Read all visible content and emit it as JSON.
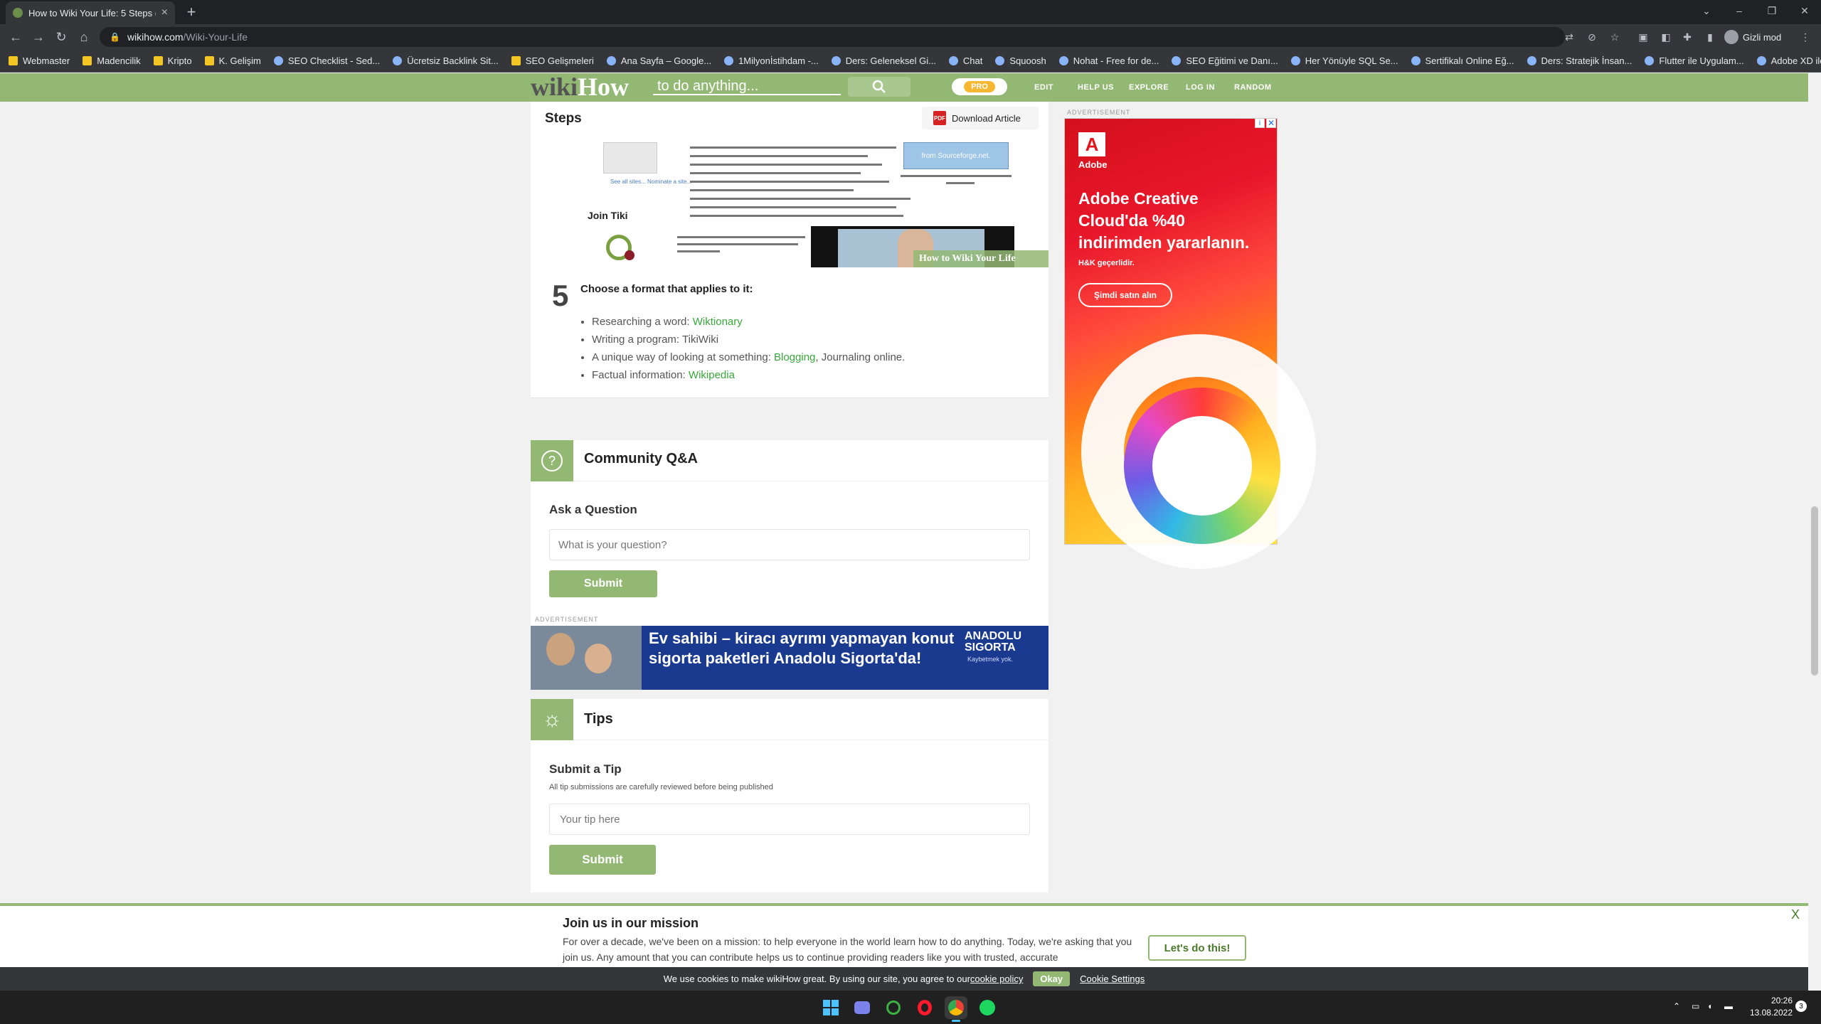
{
  "browser": {
    "tab_title": "How to Wiki Your Life: 5 Steps (w...",
    "url_host": "wikihow.com",
    "url_path": "/Wiki-Your-Life",
    "profile_label": "Gizli mod",
    "bookmarks": [
      {
        "label": "Webmaster",
        "kind": "folder"
      },
      {
        "label": "Madencilik",
        "kind": "folder"
      },
      {
        "label": "Kripto",
        "kind": "folder"
      },
      {
        "label": "K. Gelişim",
        "kind": "folder"
      },
      {
        "label": "SEO Checklist - Sed...",
        "kind": "site"
      },
      {
        "label": "Ücretsiz Backlink Sit...",
        "kind": "site"
      },
      {
        "label": "SEO Gelişmeleri",
        "kind": "folder"
      },
      {
        "label": "Ana Sayfa – Google...",
        "kind": "site"
      },
      {
        "label": "1Milyonİstihdam -...",
        "kind": "site"
      },
      {
        "label": "Ders: Geleneksel Gi...",
        "kind": "site"
      },
      {
        "label": "Chat",
        "kind": "site"
      },
      {
        "label": "Squoosh",
        "kind": "site"
      },
      {
        "label": "Nohat - Free for de...",
        "kind": "site"
      },
      {
        "label": "SEO Eğitimi ve Danı...",
        "kind": "site"
      },
      {
        "label": "Her Yönüyle SQL Se...",
        "kind": "site"
      },
      {
        "label": "Sertifikalı Online Eğ...",
        "kind": "site"
      },
      {
        "label": "Ders: Stratejik İnsan...",
        "kind": "site"
      },
      {
        "label": "Flutter ile Uygulam...",
        "kind": "site"
      },
      {
        "label": "Adobe XD ile UI-UX...",
        "kind": "site"
      }
    ]
  },
  "header": {
    "logo_a": "wiki",
    "logo_b": "How",
    "search_placeholder": "to do anything...",
    "pro_label": "PRO",
    "nav": [
      "EDIT",
      "HELP US",
      "EXPLORE",
      "LOG IN",
      "RANDOM"
    ]
  },
  "steps": {
    "title": "Steps",
    "download_label": "Download Article",
    "image": {
      "join_tiki": "Join Tiki",
      "see_all": "See all sites...\nNominate a site...",
      "sf_note": "from Sourceforge.net.",
      "video_caption": "How to Wiki Your Life"
    },
    "step5": {
      "number": "5",
      "heading": "Choose a format that applies to it:",
      "items": [
        {
          "prefix": "Researching a word: ",
          "link": "Wiktionary",
          "suffix": ""
        },
        {
          "prefix": "Writing a program: ",
          "link": "",
          "suffix": "TikiWiki"
        },
        {
          "prefix": "A unique way of looking at something: ",
          "link": "Blogging",
          "suffix": ", Journaling online."
        },
        {
          "prefix": "Factual information: ",
          "link": "Wikipedia",
          "suffix": ""
        }
      ]
    }
  },
  "qa": {
    "title": "Community Q&A",
    "ask_label": "Ask a Question",
    "input_placeholder": "What is your question?",
    "submit": "Submit"
  },
  "ads": {
    "label": "ADVERTISEMENT",
    "right": {
      "brand": "Adobe",
      "headline": "Adobe Creative Cloud'da %40 indirimden yararlanın.",
      "note": "H&K geçerlidir.",
      "cta": "Şimdi satın alın"
    },
    "banner": {
      "text": "Ev sahibi – kiracı ayrımı yapmayan konut sigorta paketleri Anadolu Sigorta'da!",
      "brand": "ANADOLU SIGORTA",
      "slogan": "Kaybetmek yok."
    }
  },
  "tips": {
    "title": "Tips",
    "submit_label": "Submit a Tip",
    "note": "All tip submissions are carefully reviewed before being published",
    "input_placeholder": "Your tip here",
    "submit": "Submit"
  },
  "mission": {
    "title": "Join us in our mission",
    "body": "For over a decade, we've been on a mission: to help everyone in the world learn how to do anything. Today, we're asking that you join us. Any amount that you can contribute helps us to continue providing readers like you with trusted, accurate",
    "cta": "Let's do this!",
    "close": "X"
  },
  "cookie": {
    "text": "We use cookies to make wikiHow great. By using our site, you agree to our ",
    "policy": "cookie policy",
    "ok": "Okay",
    "settings": "Cookie Settings"
  },
  "taskbar": {
    "time": "20:26",
    "date": "13.08.2022",
    "badge": "3"
  }
}
